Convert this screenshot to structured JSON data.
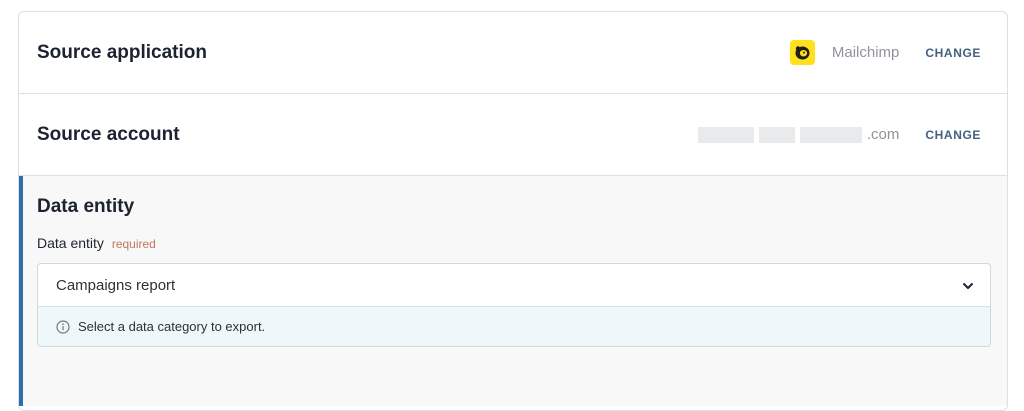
{
  "source_application": {
    "title": "Source application",
    "app_icon": "mailchimp-logo-icon",
    "app_name": "Mailchimp",
    "change_label": "CHANGE",
    "logo_color": "#ffe01b"
  },
  "source_account": {
    "title": "Source account",
    "account_visible": ".com",
    "change_label": "CHANGE"
  },
  "data_entity": {
    "section_title": "Data entity",
    "field_label": "Data entity",
    "required_label": "required",
    "selected_value": "Campaigns report",
    "hint_icon": "info-icon",
    "hint_text": "Select a data category to export.",
    "accent_color": "#2d6ea8"
  }
}
